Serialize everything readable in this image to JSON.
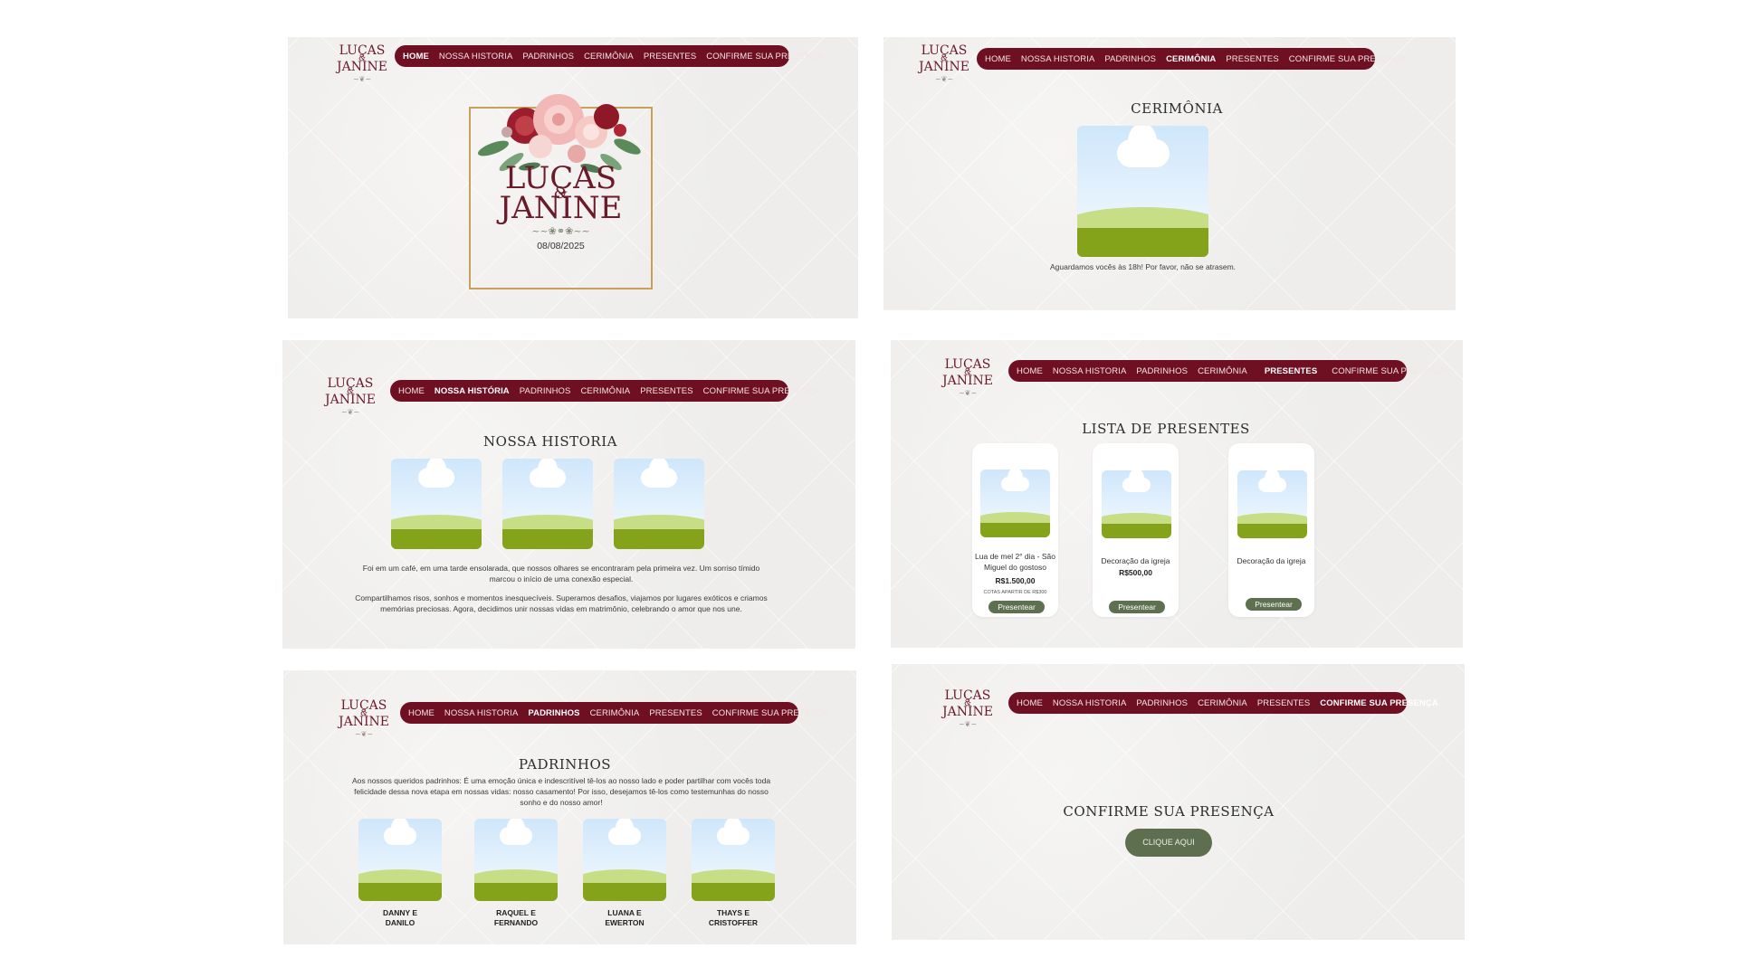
{
  "logo": {
    "line1": "LUÇAS",
    "amp": "&",
    "line2": "JANINE"
  },
  "nav": {
    "home": "HOME",
    "historia": "NOSSA HISTORIA",
    "historia_accent": "NOSSA HISTÓRIA",
    "padrinhos": "PADRINHOS",
    "cerimonia": "CERIMÔNIA",
    "presentes": "PRESENTES",
    "confirme": "CONFIRME SUA PRESENÇA"
  },
  "home": {
    "name1": "LUÇAS",
    "amp": "&",
    "name2": "JANINE",
    "date": "08/08/2025"
  },
  "ceremony": {
    "title": "CERIMÔNIA",
    "text": "Aguardamos vocês às 18h! Por favor, não se atrasem."
  },
  "story": {
    "title": "NOSSA HISTORIA",
    "p1": "Foi em um café, em uma tarde ensolarada, que nossos olhares se encontraram pela primeira vez. Um sorriso tímido marcou o início de uma conexão especial.",
    "p2": "Compartilhamos risos, sonhos e momentos inesquecíveis. Superamos desafios, viajamos por lugares exóticos e criamos memórias preciosas. Agora, decidimos unir nossas vidas em matrimônio, celebrando o amor que nos une."
  },
  "gifts": {
    "title": "LISTA DE PRESENTES",
    "button": "Presentear",
    "items": [
      {
        "name": "Lua de mel 2° dia - São Miguel do gostoso",
        "price": "R$1.500,00",
        "note": "COTAS APARTIR DE R$300"
      },
      {
        "name": "Decoração da igreja",
        "price": "R$500,00"
      },
      {
        "name": "Decoração da igreja"
      }
    ]
  },
  "godparents": {
    "title": "PADRINHOS",
    "text": "Aos nossos queridos padrinhos: É uma emoção única e indescritível tê-los ao nosso lado e poder partilhar com vocês toda felicidade dessa nova etapa em nossas vidas: nosso casamento! Por isso, desejamos tê-los como testemunhas do nosso sonho e do nosso amor!",
    "pairs": [
      {
        "a": "DANNY E",
        "b": "DANILO"
      },
      {
        "a": "RAQUEL E",
        "b": "FERNANDO"
      },
      {
        "a": "LUANA E",
        "b": "EWERTON"
      },
      {
        "a": "THAYS E",
        "b": "CRISTOFFER"
      }
    ]
  },
  "rsvp": {
    "title": "CONFIRME SUA PRESENÇA",
    "button": "CLIQUE AQUI"
  },
  "colors": {
    "nav": "#6e0f22",
    "accent_green": "#5d7050",
    "gold": "#c8a058",
    "wine": "#6b1a2a"
  }
}
